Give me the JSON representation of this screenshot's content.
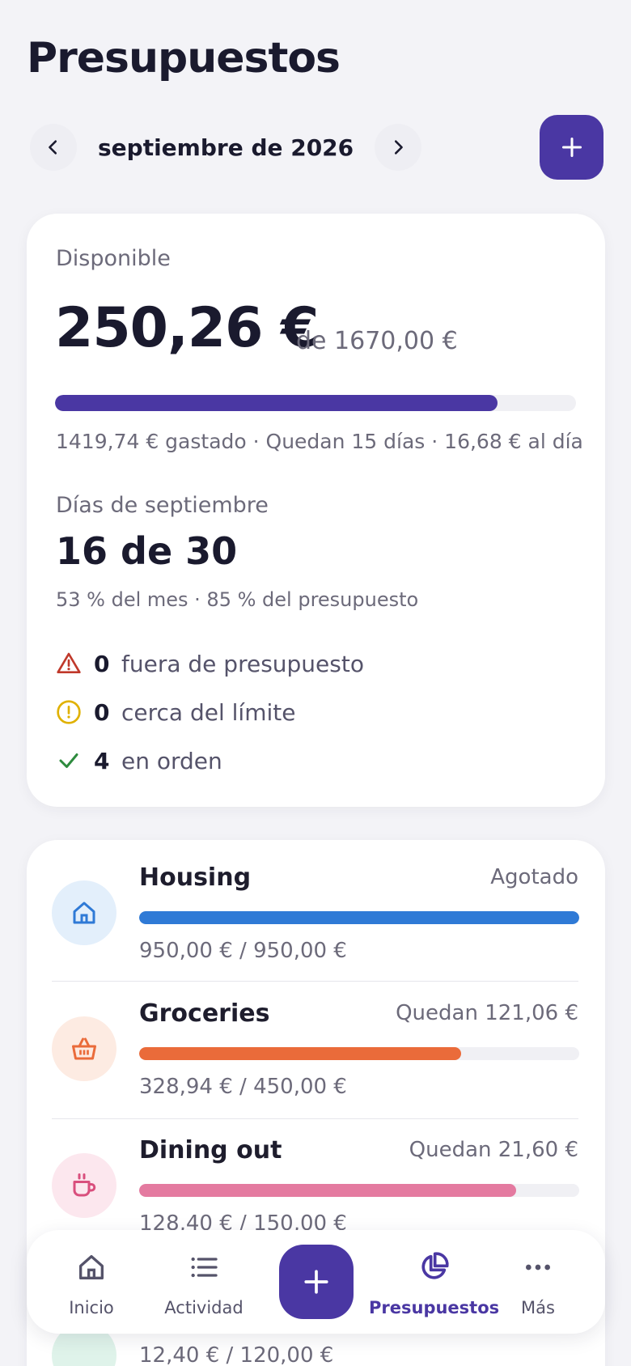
{
  "header": {
    "title": "Presupuestos"
  },
  "month_nav": {
    "prev_icon": "chevron-left-icon",
    "label": "septiembre de 2026",
    "next_icon": "chevron-right-icon",
    "add_icon": "plus-icon"
  },
  "summary": {
    "available_label": "Disponible",
    "available_amount": "250,26 €",
    "of_total": "de 1670,00 €",
    "progress": 0.85,
    "accent": "#4a37a3",
    "spent_line": "1419,74 € gastado · Quedan 15 días · 16,68 € al día",
    "days_label": "Días de septiembre",
    "days_value": "16 de 30",
    "days_sub": "53 % del mes · 85 % del presupuesto",
    "statuses": [
      {
        "count": "0",
        "label": "fuera de presupuesto",
        "icon": "warning-triangle-icon",
        "color": "#c0392b"
      },
      {
        "count": "0",
        "label": "cerca del límite",
        "icon": "alert-circle-icon",
        "color": "#e0b100"
      },
      {
        "count": "4",
        "label": "en orden",
        "icon": "check-icon",
        "color": "#2e8b3e"
      }
    ]
  },
  "categories": [
    {
      "name": "Housing",
      "remaining": "Agotado",
      "amounts": "950,00 € / 950,00 €",
      "progress": 1.0,
      "color": "#2f7ad6",
      "bg": "#e3effb",
      "icon": "home-icon"
    },
    {
      "name": "Groceries",
      "remaining": "Quedan 121,06 €",
      "amounts": "328,94 € / 450,00 €",
      "progress": 0.731,
      "color": "#ea6b3a",
      "bg": "#fdebe2",
      "icon": "basket-icon"
    },
    {
      "name": "Dining out",
      "remaining": "Quedan 21,60 €",
      "amounts": "128,40 € / 150,00 €",
      "progress": 0.856,
      "color": "#e47aa0",
      "bg": "#fce7ee",
      "icon": "coffee-cup-icon"
    }
  ],
  "hidden_row_amount": "12,40 € / 120,00 €",
  "bottom_nav": {
    "items": [
      {
        "label": "Inicio",
        "icon": "home-icon"
      },
      {
        "label": "Actividad",
        "icon": "list-icon"
      },
      {
        "label": "Presupuestos",
        "icon": "pie-chart-icon",
        "active": true
      },
      {
        "label": "Más",
        "icon": "more-dots-icon"
      }
    ],
    "add_icon": "plus-icon",
    "active_color": "#4a37a3"
  }
}
